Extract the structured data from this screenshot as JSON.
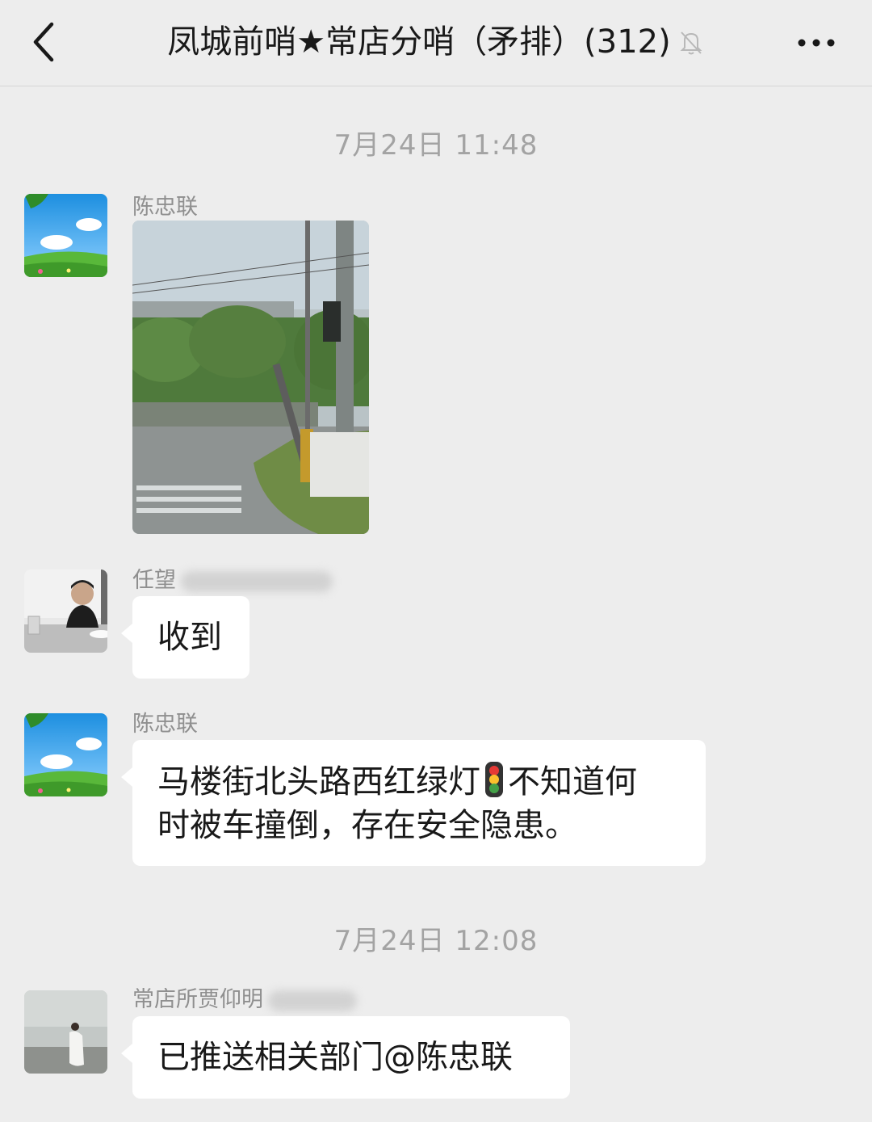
{
  "header": {
    "back_icon": "chevron-left-icon",
    "title": "凤城前哨★常店分哨（矛排）(312)",
    "mute_icon": "bell-muted-icon",
    "more_icon": "more-dots-icon"
  },
  "timestamps": [
    "7月24日 11:48",
    "7月24日 12:08"
  ],
  "messages": [
    {
      "sender": "陈忠联",
      "type": "image",
      "image": "street-photo-fallen-traffic-light"
    },
    {
      "sender": "任望",
      "type": "text",
      "text": "收到"
    },
    {
      "sender": "陈忠联",
      "type": "text",
      "line1_before": "马楼街北头路西红绿灯",
      "emoji": "traffic-light-icon",
      "line1_after": "不知道何",
      "line2": "时被车撞倒，存在安全隐患。"
    },
    {
      "sender": "常店所贾仰明",
      "type": "text",
      "text": "已推送相关部门@陈忠联"
    }
  ],
  "colors": {
    "background": "#ededed",
    "bubble": "#ffffff",
    "meta_text": "#a3a3a3"
  }
}
